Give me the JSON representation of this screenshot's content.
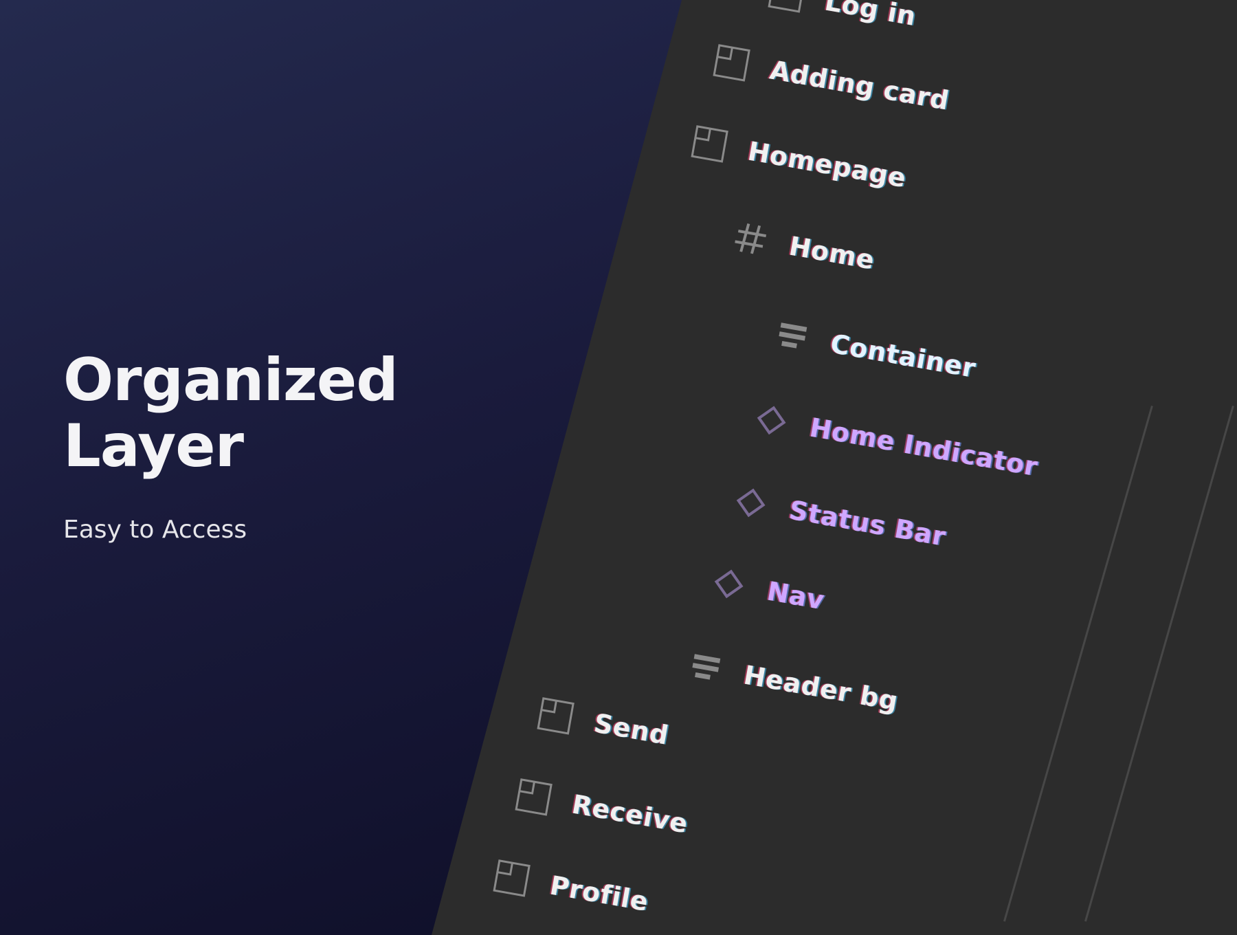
{
  "hero": {
    "title_line1": "Organized",
    "title_line2": "Layer",
    "subtitle": "Easy to Access"
  },
  "layers": [
    {
      "label": "Log in",
      "icon": "frame-icon"
    },
    {
      "label": "Adding card",
      "icon": "frame-icon"
    },
    {
      "label": "Homepage",
      "icon": "frame-icon"
    },
    {
      "label": "Home",
      "icon": "hash-icon"
    },
    {
      "label": "Container",
      "icon": "autolayout-icon"
    },
    {
      "label": "Home Indicator",
      "icon": "component-icon"
    },
    {
      "label": "Status Bar",
      "icon": "component-icon"
    },
    {
      "label": "Nav",
      "icon": "component-icon"
    },
    {
      "label": "Header bg",
      "icon": "autolayout-icon"
    },
    {
      "label": "Send",
      "icon": "frame-icon"
    },
    {
      "label": "Receive",
      "icon": "frame-icon"
    },
    {
      "label": "Profile",
      "icon": "frame-icon"
    }
  ],
  "colors": {
    "background_top": "#242a4e",
    "background_bottom": "#0b0b22",
    "panel": "#2c2c2c",
    "label_text": "#f0f0f0",
    "component_text": "#cfa7ff",
    "icon_gray": "#8a8a8a",
    "component_icon": "#7a6a94"
  }
}
